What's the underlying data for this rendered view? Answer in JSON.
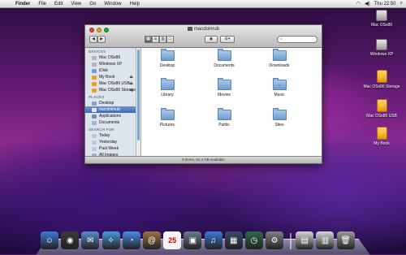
{
  "menubar": {
    "app": "Finder",
    "items": [
      "File",
      "Edit",
      "View",
      "Go",
      "Window",
      "Help"
    ],
    "clock": "Thu 22:50"
  },
  "window": {
    "title": "macdolmub",
    "search_placeholder": "",
    "status": "9 items, 91.4 GB available",
    "sidebar": {
      "devices_header": "DEVICES",
      "devices": [
        {
          "label": "Mac OSx86",
          "icon": "hdd-icon",
          "color": "#b5b5b5"
        },
        {
          "label": "Windows XP",
          "icon": "hdd-icon",
          "color": "#b5b5b5"
        },
        {
          "label": "iDisk",
          "icon": "idisk-icon",
          "color": "#6aa0d8"
        },
        {
          "label": "My Book",
          "icon": "external-drive-icon",
          "color": "#f0a020",
          "eject": true
        },
        {
          "label": "Mac OSx86 USB",
          "icon": "external-drive-icon",
          "color": "#f0a020",
          "eject": true
        },
        {
          "label": "Mac OSx86 Storage",
          "icon": "external-drive-icon",
          "color": "#f0a020",
          "eject": true
        }
      ],
      "places_header": "PLACES",
      "places": [
        {
          "label": "Desktop",
          "icon": "desktop-icon",
          "color": "#8aa0c0"
        },
        {
          "label": "macdolmub",
          "icon": "home-icon",
          "color": "#e8e8e8",
          "selected": true
        },
        {
          "label": "Applications",
          "icon": "applications-icon",
          "color": "#7a8ab0"
        },
        {
          "label": "Documents",
          "icon": "documents-icon",
          "color": "#a0b8d8"
        }
      ],
      "search_header": "SEARCH FOR",
      "searches": [
        {
          "label": "Today",
          "icon": "clock-icon",
          "color": "#c0c8d8"
        },
        {
          "label": "Yesterday",
          "icon": "clock-icon",
          "color": "#c0c8d8"
        },
        {
          "label": "Past Week",
          "icon": "clock-icon",
          "color": "#c0c8d8"
        },
        {
          "label": "All Images",
          "icon": "smart-folder-icon",
          "color": "#9fb0c8"
        }
      ]
    },
    "folders": [
      {
        "label": "Desktop",
        "icon": "desktop-folder-icon",
        "glyph": ""
      },
      {
        "label": "Documents",
        "icon": "documents-folder-icon",
        "glyph": ""
      },
      {
        "label": "Downloads",
        "icon": "downloads-folder-icon",
        "glyph": "↓"
      },
      {
        "label": "Library",
        "icon": "library-folder-icon",
        "glyph": ""
      },
      {
        "label": "Movies",
        "icon": "movies-folder-icon",
        "glyph": ""
      },
      {
        "label": "Music",
        "icon": "music-folder-icon",
        "glyph": "♪"
      },
      {
        "label": "Pictures",
        "icon": "pictures-folder-icon",
        "glyph": ""
      },
      {
        "label": "Public",
        "icon": "public-folder-icon",
        "glyph": ""
      },
      {
        "label": "Sites",
        "icon": "sites-folder-icon",
        "glyph": ""
      }
    ]
  },
  "desktop_icons": [
    {
      "label": "Mac OSx86",
      "icon": "hard-drive-icon",
      "kind": "hdd"
    },
    {
      "label": "Windows XP",
      "icon": "hard-drive-icon",
      "kind": "hdd"
    },
    {
      "label": "Mac OSx86 Storage",
      "icon": "external-drive-icon",
      "kind": "ext"
    },
    {
      "label": "Mac OSx86 USB",
      "icon": "external-drive-icon",
      "kind": "ext"
    },
    {
      "label": "My Book",
      "icon": "external-drive-icon",
      "kind": "ext"
    }
  ],
  "dock": [
    {
      "name": "finder-dock-icon",
      "glyph": "☺",
      "color": "#3d7ad6"
    },
    {
      "name": "dashboard-dock-icon",
      "glyph": "◉",
      "color": "#3a3a3a"
    },
    {
      "name": "mail-dock-icon",
      "glyph": "✉",
      "color": "#5a8ad0"
    },
    {
      "name": "safari-dock-icon",
      "glyph": "✧",
      "color": "#4a9ae0"
    },
    {
      "name": "ichat-dock-icon",
      "glyph": "◔",
      "color": "#4a8ae8"
    },
    {
      "name": "address-book-dock-icon",
      "glyph": "@",
      "color": "#a07040"
    },
    {
      "name": "ical-dock-icon",
      "glyph": "25",
      "color": "#e8e8e8"
    },
    {
      "name": "iphoto-dock-icon",
      "glyph": "▣",
      "color": "#6a7a90"
    },
    {
      "name": "itunes-dock-icon",
      "glyph": "♫",
      "color": "#3a7ad8"
    },
    {
      "name": "spaces-dock-icon",
      "glyph": "▦",
      "color": "#3a4a6a"
    },
    {
      "name": "time-machine-dock-icon",
      "glyph": "◷",
      "color": "#2a6a4a"
    },
    {
      "name": "system-preferences-dock-icon",
      "glyph": "⚙",
      "color": "#808080"
    },
    {
      "name": "documents-stack-dock-icon",
      "glyph": "▤",
      "color": "#d8d8d8"
    },
    {
      "name": "downloads-stack-dock-icon",
      "glyph": "▥",
      "color": "#d8d8d8"
    },
    {
      "name": "trash-dock-icon",
      "glyph": "🗑",
      "color": "#9a9a9a"
    }
  ]
}
